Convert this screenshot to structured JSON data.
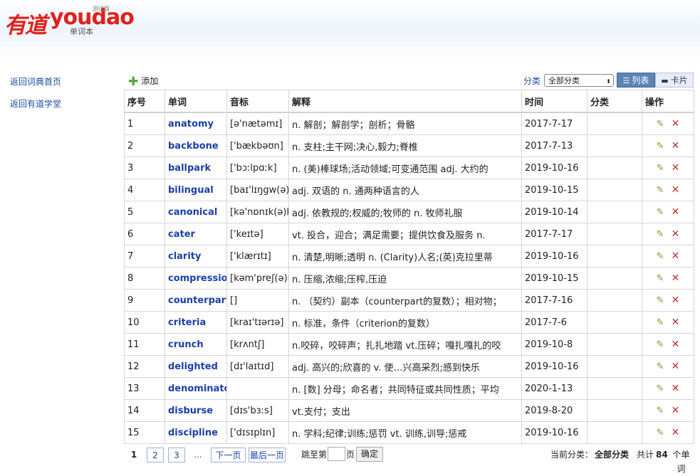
{
  "header": {
    "logo_cn": "有道",
    "logo_en": "youdao",
    "logo_badge": "测试版",
    "logo_sub": "单词本"
  },
  "sidebar": {
    "items": [
      {
        "label": "返回词典首页"
      },
      {
        "label": "返回有道学堂"
      }
    ]
  },
  "toolbar": {
    "add_label": "添加",
    "category_label": "分类",
    "category_value": "全部分类",
    "view_list_label": "列表",
    "view_card_label": "卡片"
  },
  "table": {
    "headers": [
      "序号",
      "单词",
      "音标",
      "解释",
      "时间",
      "分类",
      "操作"
    ],
    "rows": [
      {
        "no": "1",
        "word": "anatomy",
        "phonetic": "[ə'nætəmɪ]",
        "meaning": "n. 解剖；解剖学；剖析；骨骼",
        "time": "2017-7-17",
        "category": ""
      },
      {
        "no": "2",
        "word": "backbone",
        "phonetic": "['bækbəʊn]",
        "meaning": "n. 支柱;主干网;决心,毅力;脊椎",
        "time": "2017-7-13",
        "category": ""
      },
      {
        "no": "3",
        "word": "ballpark",
        "phonetic": "['bɔːlpɑːk]",
        "meaning": "n. (美)棒球场;活动领域;可变通范围 adj. 大约的",
        "time": "2019-10-16",
        "category": ""
      },
      {
        "no": "4",
        "word": "bilingual",
        "phonetic": "[baɪ'lɪŋgw(ə)l]",
        "meaning": "adj. 双语的 n. 通两种语言的人",
        "time": "2019-10-15",
        "category": ""
      },
      {
        "no": "5",
        "word": "canonical",
        "phonetic": "[kə'nɒnɪk(ə)l]",
        "meaning": "adj. 依教规的;权威的;牧师的 n. 牧师礼服",
        "time": "2019-10-14",
        "category": ""
      },
      {
        "no": "6",
        "word": "cater",
        "phonetic": "['keɪtə]",
        "meaning": "vt. 投合，迎合；满足需要；提供饮食及服务 n.",
        "time": "2017-7-17",
        "category": ""
      },
      {
        "no": "7",
        "word": "clarity",
        "phonetic": "['klærɪtɪ]",
        "meaning": "n. 清楚,明晰;透明 n. (Clarity)人名;(英)克拉里蒂",
        "time": "2019-10-16",
        "category": ""
      },
      {
        "no": "8",
        "word": "compression",
        "phonetic": "[kəm'preʃ(ə)n]",
        "meaning": "n. 压缩,浓缩;压榨,压迫",
        "time": "2019-10-15",
        "category": ""
      },
      {
        "no": "9",
        "word": "counterparts",
        "phonetic": "[]",
        "meaning": "n. （契约）副本（counterpart的复数）；相对物；",
        "time": "2017-7-16",
        "category": ""
      },
      {
        "no": "10",
        "word": "criteria",
        "phonetic": "[kraɪ'tɪərɪə]",
        "meaning": "n. 标准，条件（criterion的复数）",
        "time": "2017-7-6",
        "category": ""
      },
      {
        "no": "11",
        "word": "crunch",
        "phonetic": "[krʌntʃ]",
        "meaning": "n.咬碎，咬碎声；扎扎地踏 vt.压碎；嘎扎嘎扎的咬",
        "time": "2019-10-8",
        "category": ""
      },
      {
        "no": "12",
        "word": "delighted",
        "phonetic": "[dɪ'laɪtɪd]",
        "meaning": "adj. 高兴的;欣喜的 v. 使…兴高采烈;感到快乐",
        "time": "2019-10-16",
        "category": ""
      },
      {
        "no": "13",
        "word": "denominator",
        "phonetic": "",
        "meaning": "n. [数] 分母；命名者；共同特征或共同性质；平均",
        "time": "2020-1-13",
        "category": ""
      },
      {
        "no": "14",
        "word": "disburse",
        "phonetic": "[dɪs'bɜːs]",
        "meaning": "vt.支付；支出",
        "time": "2019-8-20",
        "category": ""
      },
      {
        "no": "15",
        "word": "discipline",
        "phonetic": "['dɪsɪplɪn]",
        "meaning": "n. 学科;纪律;训练;惩罚 vt. 训练,训导;惩戒",
        "time": "2019-10-16",
        "category": ""
      }
    ]
  },
  "pager": {
    "current": "1",
    "pages": [
      "2",
      "3"
    ],
    "ellipsis": "...",
    "next_label": "下一页",
    "last_label": "最后一页",
    "jump_prefix": "跳至第",
    "jump_suffix": "页",
    "confirm_label": "确定",
    "status_prefix": "当前分类：",
    "status_category": "全部分类",
    "total_prefix": "共计",
    "total_count": "84",
    "total_suffix": "个单词"
  }
}
